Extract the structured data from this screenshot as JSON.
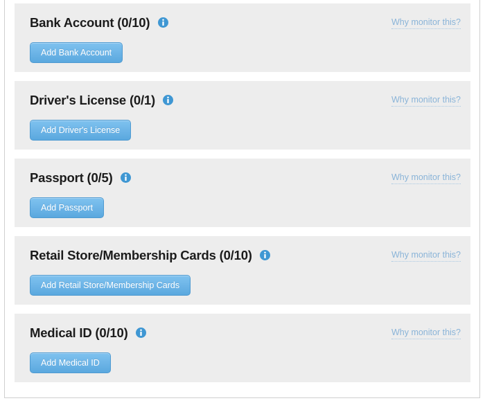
{
  "theme": {
    "card_bg": "#ededed",
    "page_bg": "#ffffff",
    "button_accent": "#6fb6e8",
    "link_color": "#8ab4d8",
    "title_color": "#1b1b1b",
    "border_color": "#cfcfcf"
  },
  "sections": [
    {
      "title": "Bank Account (0/10)",
      "name": "Bank Account",
      "count": "0/10",
      "info_icon": "info-circle-icon",
      "why_link": "Why monitor this?",
      "add_label": "Add Bank Account"
    },
    {
      "title": "Driver's License (0/1)",
      "name": "Driver's License",
      "count": "0/1",
      "info_icon": "info-circle-icon",
      "why_link": "Why monitor this?",
      "add_label": "Add Driver's License"
    },
    {
      "title": "Passport (0/5)",
      "name": "Passport",
      "count": "0/5",
      "info_icon": "info-circle-icon",
      "why_link": "Why monitor this?",
      "add_label": "Add Passport"
    },
    {
      "title": "Retail Store/Membership Cards (0/10)",
      "name": "Retail Store/Membership Cards",
      "count": "0/10",
      "info_icon": "info-circle-icon",
      "why_link": "Why monitor this?",
      "add_label": "Add Retail Store/Membership Cards"
    },
    {
      "title": "Medical ID (0/10)",
      "name": "Medical ID",
      "count": "0/10",
      "info_icon": "info-circle-icon",
      "why_link": "Why monitor this?",
      "add_label": "Add Medical ID"
    }
  ]
}
